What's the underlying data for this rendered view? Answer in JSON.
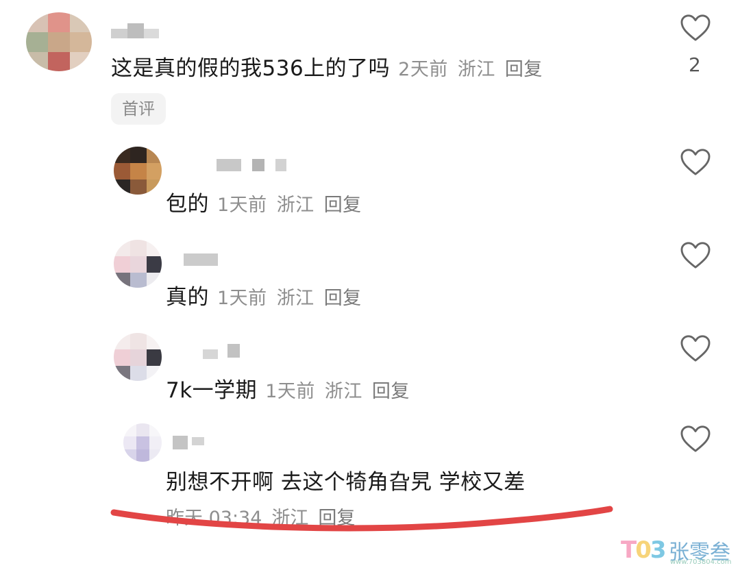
{
  "comments": [
    {
      "text": "这是真的假的我536上的了吗",
      "time": "2天前",
      "location": "浙江",
      "reply": "回复",
      "likes": "2",
      "tag": "首评"
    },
    {
      "text": "包的",
      "time": "1天前",
      "location": "浙江",
      "reply": "回复"
    },
    {
      "text": "真的",
      "time": "1天前",
      "location": "浙江",
      "reply": "回复"
    },
    {
      "text": "7k一学期",
      "time": "1天前",
      "location": "浙江",
      "reply": "回复"
    },
    {
      "text": "别想不开啊 去这个犄角旮旯 学校又差",
      "time": "昨天 03:34",
      "location": "浙江",
      "reply": "回复"
    }
  ],
  "watermark": {
    "logo": "T03",
    "name": "张零叁",
    "url": "www.703804.com"
  },
  "colors": {
    "text": "#1a1a1a",
    "meta": "#8e8e8e",
    "underline": "#e24545",
    "tag_bg": "#f3f3f3"
  }
}
